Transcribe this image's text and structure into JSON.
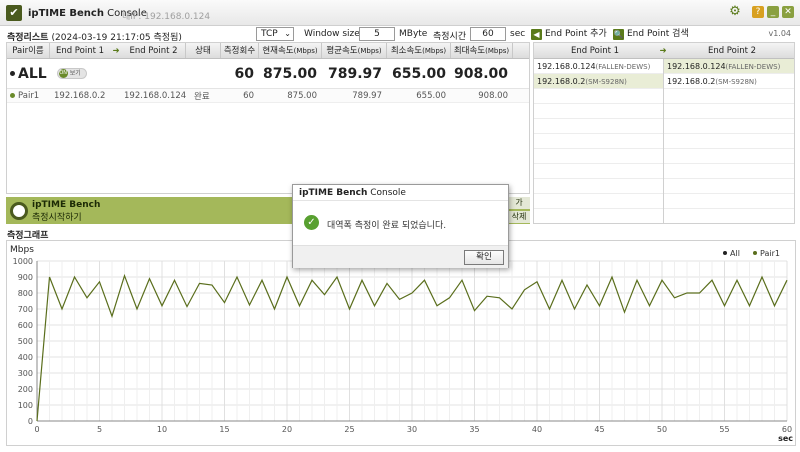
{
  "window": {
    "title_bold": "ipTIME Bench",
    "title_light": " Console",
    "ip_label": "내IP: 192.168.0.124",
    "version": "v1.04"
  },
  "toolbar": {
    "list_title": "측정리스트",
    "list_status": "(2024-03-19 21:17:05 측정됨)",
    "protocol": "TCP",
    "window_size_label": "Window size",
    "window_size_value": "5",
    "window_size_unit": "MByte",
    "duration_label": "측정시간",
    "duration_value": "60",
    "duration_unit": "sec",
    "add_endpoint_label": "End Point 추가",
    "search_endpoint_label": "End Point 검색"
  },
  "table": {
    "headers": {
      "pair": "Pair이름",
      "ep1": "End Point 1",
      "arrow": "➜",
      "ep2": "End Point 2",
      "state": "상태",
      "count": "측정회수",
      "current": "현재속도",
      "average": "평균속도",
      "min": "최소속도",
      "max": "최대속도",
      "unit": "(Mbps)"
    },
    "all_row": {
      "name": "ALL",
      "toggle": "보기",
      "count": "60",
      "current": "875.00",
      "average": "789.97",
      "min": "655.00",
      "max": "908.00"
    },
    "pair_row": {
      "name": "Pair1",
      "ep1": "192.168.0.2",
      "ep2": "192.168.0.124",
      "state": "완료",
      "count": "60",
      "current": "875.00",
      "average": "789.97",
      "min": "655.00",
      "max": "908.00"
    }
  },
  "endpoints": {
    "header1": "End Point 1",
    "arrow": "➜",
    "header2": "End Point 2",
    "left": [
      {
        "ip": "192.168.0.124",
        "host": "(FALLEN-DEWS)"
      },
      {
        "ip": "192.168.0.2",
        "host": "(SM-S928N)"
      }
    ],
    "right": [
      {
        "ip": "192.168.0.124",
        "host": "(FALLEN-DEWS)"
      },
      {
        "ip": "192.168.0.2",
        "host": "(SM-S928N)"
      }
    ]
  },
  "status": {
    "title": "ipTIME Bench",
    "subtitle": "측정시작하기",
    "side_btn1": "가",
    "side_btn2": "삭제"
  },
  "graph": {
    "title": "측정그래프",
    "ylabel": "Mbps",
    "xunit": "sec"
  },
  "dialog": {
    "title_bold": "ipTIME Bench",
    "title_light": " Console",
    "message": "대역폭 측정이 완료 되었습니다.",
    "ok": "확인"
  },
  "chart_data": {
    "type": "line",
    "ylabel": "Mbps",
    "xlabel": "sec",
    "xlim": [
      0,
      60
    ],
    "ylim": [
      0,
      1000
    ],
    "xticks": [
      0,
      5,
      10,
      15,
      20,
      25,
      30,
      35,
      40,
      45,
      50,
      55,
      60
    ],
    "yticks": [
      0,
      100,
      200,
      300,
      400,
      500,
      600,
      700,
      800,
      900,
      1000
    ],
    "grid": true,
    "legend_position": "top-right",
    "colors": {
      "All": "#222222",
      "Pair1": "#5a6e1c"
    },
    "series": [
      {
        "name": "All",
        "values": []
      },
      {
        "name": "Pair1",
        "x": [
          0,
          1,
          2,
          3,
          4,
          5,
          6,
          7,
          8,
          9,
          10,
          11,
          12,
          13,
          14,
          15,
          16,
          17,
          18,
          19,
          20,
          21,
          22,
          23,
          24,
          25,
          26,
          27,
          28,
          29,
          30,
          31,
          32,
          33,
          34,
          35,
          36,
          37,
          38,
          39,
          40,
          41,
          42,
          43,
          44,
          45,
          46,
          47,
          48,
          49,
          50,
          51,
          52,
          53,
          54,
          55,
          56,
          57,
          58,
          59,
          60
        ],
        "values": [
          0,
          900,
          700,
          900,
          770,
          870,
          655,
          908,
          700,
          890,
          720,
          880,
          715,
          860,
          850,
          740,
          900,
          725,
          880,
          700,
          900,
          720,
          880,
          790,
          900,
          700,
          880,
          720,
          860,
          760,
          800,
          880,
          720,
          770,
          880,
          690,
          780,
          770,
          700,
          820,
          870,
          700,
          880,
          700,
          850,
          720,
          900,
          680,
          880,
          720,
          880,
          770,
          800,
          800,
          880,
          720,
          880,
          720,
          900,
          720,
          880
        ]
      }
    ]
  }
}
